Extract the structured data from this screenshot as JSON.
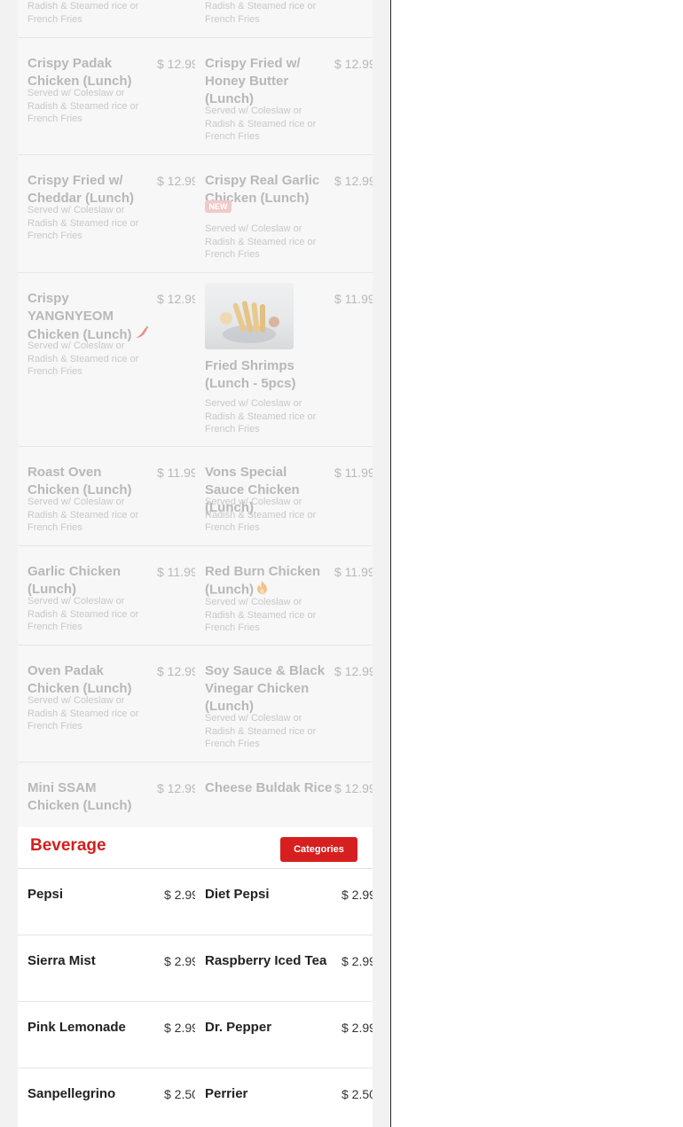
{
  "lunch": {
    "top_partial": {
      "left_desc": "Radish & Steamed rice or French Fries",
      "right_desc": "Radish & Steamed rice or French Fries"
    },
    "items": [
      {
        "name": "Crispy Padak Chicken (Lunch)",
        "price": "$ 12.99",
        "desc": "Served w/ Coleslaw or Radish & Steamed rice or French Fries"
      },
      {
        "name": "Crispy Fried w/ Honey Butter (Lunch)",
        "price": "$ 12.99",
        "desc": "Served w/ Coleslaw or Radish & Steamed rice or French Fries"
      },
      {
        "name": "Crispy Fried w/ Cheddar (Lunch)",
        "price": "$ 12.99",
        "desc": "Served w/ Coleslaw or Radish & Steamed rice or French Fries"
      },
      {
        "name": "Crispy Real Garlic Chicken (Lunch)",
        "price": "$ 12.99",
        "badge": "NEW",
        "desc": "Served w/ Coleslaw or Radish & Steamed rice or French Fries"
      },
      {
        "name": "Crispy YANGNYEOM Chicken (Lunch)",
        "price": "$ 12.99",
        "icon": "chili-pepper-icon",
        "desc": "Served w/ Coleslaw or Radish & Steamed rice or French Fries"
      },
      {
        "name": "Fried Shrimps (Lunch - 5pcs)",
        "price": "$ 11.99",
        "image": "fried-shrimp-photo",
        "desc": "Served w/ Coleslaw or Radish & Steamed rice or French Fries"
      },
      {
        "name": "Roast Oven Chicken (Lunch)",
        "price": "$ 11.99",
        "desc": "Served w/ Coleslaw or Radish & Steamed rice or French Fries"
      },
      {
        "name": "Vons Special Sauce Chicken (Lunch)",
        "price": "$ 11.99",
        "desc": "Served w/ Coleslaw or Radish & Steamed rice or French Fries"
      },
      {
        "name": "Garlic Chicken (Lunch)",
        "price": "$ 11.99",
        "desc": "Served w/ Coleslaw or Radish & Steamed rice or French Fries"
      },
      {
        "name": "Red Burn Chicken (Lunch)",
        "price": "$ 11.99",
        "icon": "fire-icon",
        "desc": "Served w/ Coleslaw or Radish & Steamed rice or French Fries"
      },
      {
        "name": "Oven Padak Chicken (Lunch)",
        "price": "$ 12.99",
        "desc": "Served w/ Coleslaw or Radish & Steamed rice or French Fries"
      },
      {
        "name": "Soy Sauce & Black Vinegar Chicken (Lunch)",
        "price": "$ 12.99",
        "desc": "Served w/ Coleslaw or Radish & Steamed rice or French Fries"
      },
      {
        "name": "Mini SSAM Chicken (Lunch)",
        "price": "$ 12.99"
      },
      {
        "name": "Cheese Buldak Rice",
        "price": "$ 12.99"
      }
    ]
  },
  "beverage": {
    "title": "Beverage",
    "categories_button": "Categories",
    "items": [
      {
        "name": "Pepsi",
        "price": "$ 2.99"
      },
      {
        "name": "Diet Pepsi",
        "price": "$ 2.99"
      },
      {
        "name": "Sierra Mist",
        "price": "$ 2.99"
      },
      {
        "name": "Raspberry Iced Tea",
        "price": "$ 2.99"
      },
      {
        "name": "Pink Lemonade",
        "price": "$ 2.99"
      },
      {
        "name": "Dr. Pepper",
        "price": "$ 2.99"
      },
      {
        "name": "Sanpellegrino",
        "price": "$ 2.50"
      },
      {
        "name": "Perrier",
        "price": "$ 2.50"
      }
    ]
  },
  "colors": {
    "accent_red": "#d61f1f",
    "title_red": "#d11f1f",
    "muted_text": "#8a8a8a"
  }
}
